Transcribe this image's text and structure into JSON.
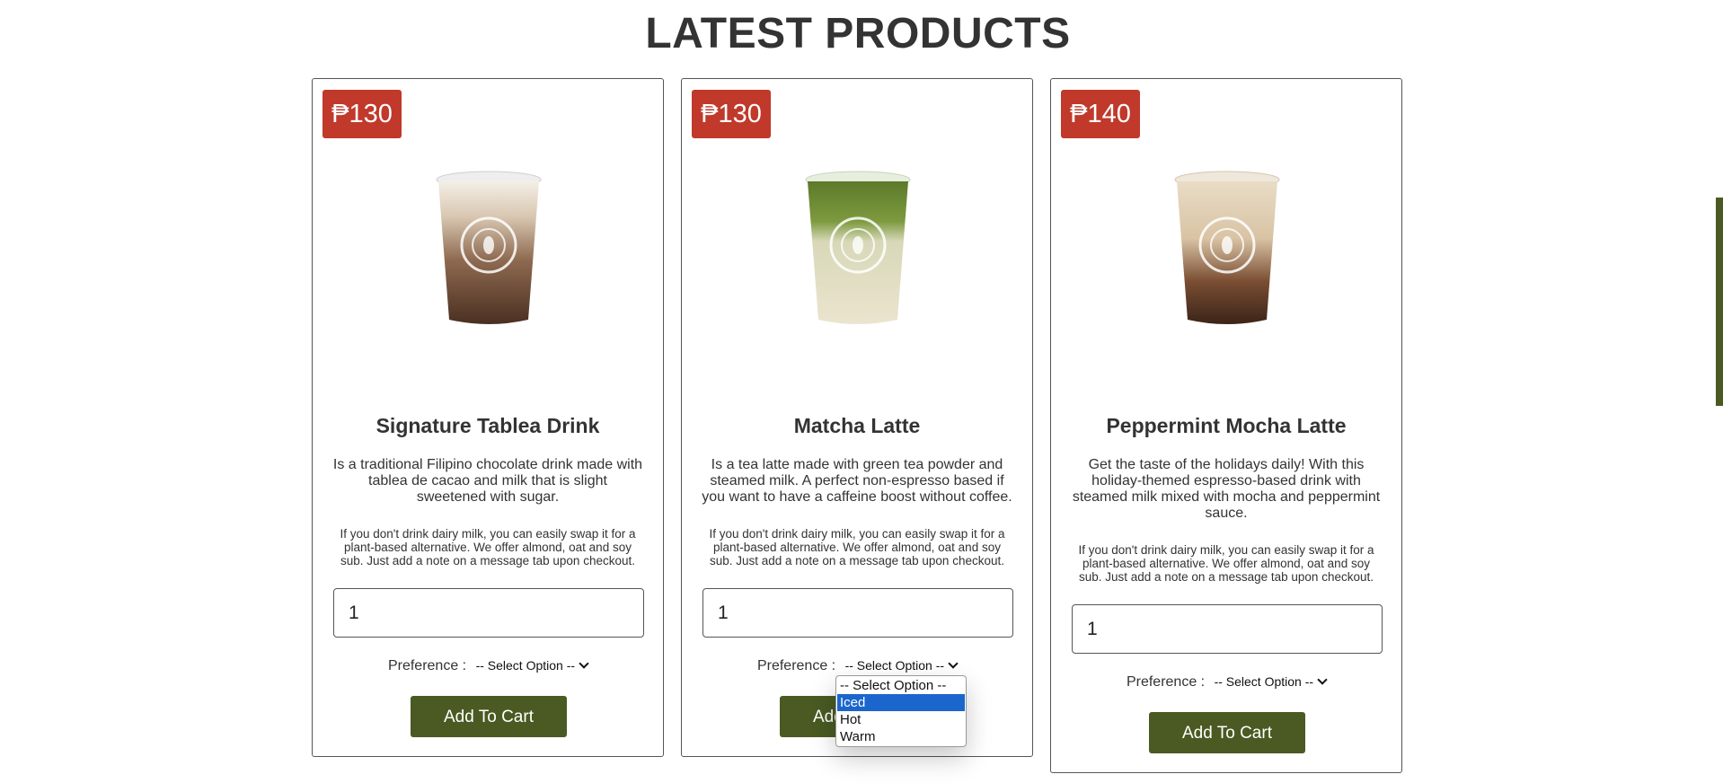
{
  "section": {
    "title": "LATEST PRODUCTS"
  },
  "products": [
    {
      "price": "₱130",
      "name": "Signature Tablea Drink",
      "description": "Is a traditional Filipino chocolate drink made with tablea de cacao and milk that is slight sweetened with sugar.",
      "note": "If you don't drink dairy milk, you can easily swap it for a plant-based alternative. We offer almond, oat and soy sub. Just add a note on a message tab upon checkout.",
      "quantity": "1",
      "preference_label": "Preference :",
      "preference_value": "-- Select Option --",
      "button_label": "Add To Cart"
    },
    {
      "price": "₱130",
      "name": "Matcha Latte",
      "description": "Is a tea latte made with green tea powder and steamed milk. A perfect non-espresso based if you want to have a caffeine boost without coffee.",
      "note": "If you don't drink dairy milk, you can easily swap it for a plant-based alternative. We offer almond, oat and soy sub. Just add a note on a message tab upon checkout.",
      "quantity": "1",
      "preference_label": "Preference :",
      "preference_value": "-- Select Option --",
      "button_label": "Add To Cart"
    },
    {
      "price": "₱140",
      "name": "Peppermint Mocha Latte",
      "description": "Get the taste of the holidays daily! With this holiday-themed espresso-based drink with steamed milk mixed with mocha and peppermint sauce.",
      "note": "If you don't drink dairy milk, you can easily swap it for a plant-based alternative. We offer almond, oat and soy sub. Just add a note on a message tab upon checkout.",
      "quantity": "1",
      "preference_label": "Preference :",
      "preference_value": "-- Select Option --",
      "button_label": "Add To Cart"
    }
  ],
  "open_dropdown": {
    "options": [
      "-- Select Option --",
      "Iced",
      "Hot",
      "Warm"
    ],
    "highlighted": "Iced"
  },
  "colors": {
    "price_badge": "#c0392b",
    "button": "#4a5a22",
    "highlight": "#1a66cc"
  },
  "icons": {
    "dropdown": "chevron-down-icon"
  }
}
